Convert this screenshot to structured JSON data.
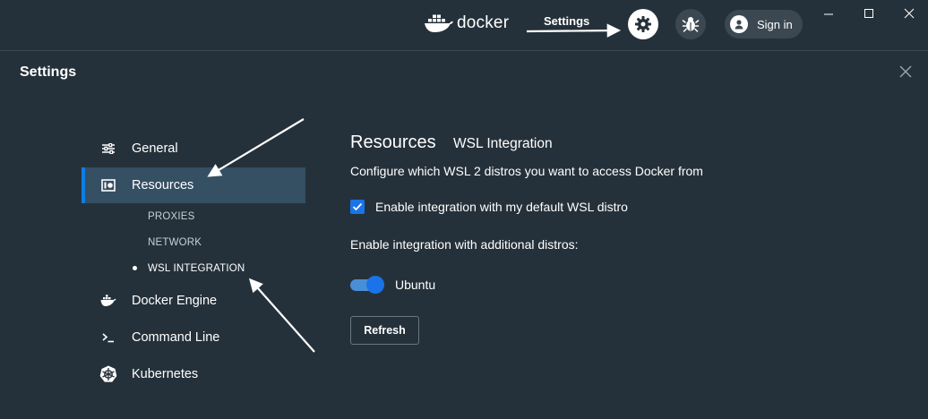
{
  "titlebar": {
    "logo_text": "docker",
    "annotation_label": "Settings",
    "sign_in_label": "Sign in",
    "icons": {
      "logo": "docker-whale-icon",
      "settings": "gear-icon",
      "troubleshoot": "bug-icon",
      "avatar": "user-avatar-icon",
      "minimize": "minimize-icon",
      "maximize": "maximize-icon",
      "close": "close-icon"
    }
  },
  "settings": {
    "title": "Settings",
    "close_icon": "close-icon"
  },
  "sidebar": {
    "items": [
      {
        "label": "General",
        "icon": "sliders-icon"
      },
      {
        "label": "Resources",
        "icon": "resources-icon",
        "active": true
      },
      {
        "label": "Docker Engine",
        "icon": "whale-icon"
      },
      {
        "label": "Command Line",
        "icon": "terminal-icon"
      },
      {
        "label": "Kubernetes",
        "icon": "kubernetes-helm-icon"
      }
    ],
    "subitems": [
      {
        "label": "PROXIES"
      },
      {
        "label": "NETWORK"
      },
      {
        "label": "WSL INTEGRATION",
        "active": true
      }
    ]
  },
  "main": {
    "title": "Resources",
    "subtitle": "WSL Integration",
    "description": "Configure which WSL 2 distros you want to access Docker from",
    "default_distro_checkbox": {
      "label": "Enable integration with my default WSL distro",
      "checked": true
    },
    "additional_label": "Enable integration with additional distros:",
    "distros": [
      {
        "label": "Ubuntu",
        "enabled": true
      }
    ],
    "refresh_label": "Refresh"
  },
  "colors": {
    "background": "#25313a",
    "active_item": "#354f63",
    "accent": "#0b7fe5",
    "checkbox": "#1a73e8",
    "button_bg": "#3b4852"
  }
}
